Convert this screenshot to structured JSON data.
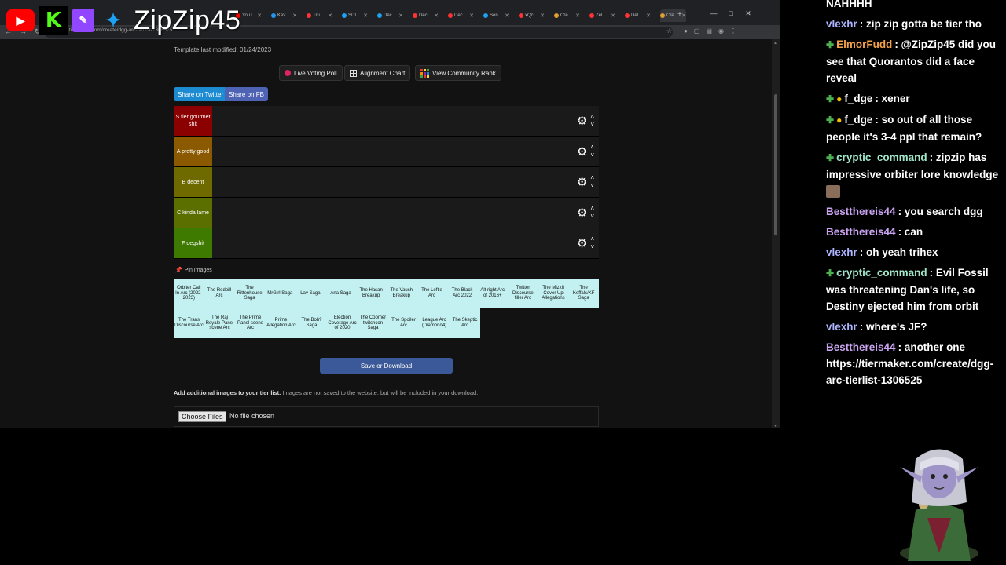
{
  "browser": {
    "tabs": [
      {
        "label": "YouT",
        "color": "#ff0000"
      },
      {
        "label": "Kev",
        "color": "#2196f3"
      },
      {
        "label": "Tru",
        "color": "#ff3333"
      },
      {
        "label": "SDI",
        "color": "#1da1f2"
      },
      {
        "label": "Dec",
        "color": "#1da1f2"
      },
      {
        "label": "Dec",
        "color": "#ff3333"
      },
      {
        "label": "Dec",
        "color": "#ff3333"
      },
      {
        "label": "Sen",
        "color": "#1da1f2"
      },
      {
        "label": "xQc",
        "color": "#ff3333"
      },
      {
        "label": "Cre",
        "color": "#e0a030"
      },
      {
        "label": "Zel",
        "color": "#ff3333"
      },
      {
        "label": "Del",
        "color": "#ff3333"
      },
      {
        "label": "Cre",
        "color": "#e0a030"
      }
    ],
    "url": "tiermaker.com/create/dgg-arc-tierlist-1306525"
  },
  "page": {
    "template_modified": "Template last modified: 01/24/2023",
    "buttons": {
      "live_poll": "Live Voting Poll",
      "alignment": "Alignment Chart",
      "community_rank": "View Community Rank",
      "share_twitter": "Share on Twitter",
      "share_fb": "Share on FB"
    },
    "tiers": [
      {
        "label": "S tier gourmet shit",
        "color": "#8b0000"
      },
      {
        "label": "A pretty good",
        "color": "#8b5a00"
      },
      {
        "label": "B decent",
        "color": "#6e6a00"
      },
      {
        "label": "C kinda lame",
        "color": "#5b6e00"
      },
      {
        "label": "F degshit",
        "color": "#3f7a00"
      }
    ],
    "pin_images": "Pin Images",
    "pool_rows": [
      [
        "Orbiter Call In Arc (2022-2023)",
        "The Redpill Arc",
        "The Rittenhouse Saga",
        "MrGirl Saga",
        "Lav Saga",
        "Ana Saga",
        "The Hasan Breakup",
        "The Vaush Breakup",
        "The Leftie Arc",
        "The Black Arc 2022",
        "Alt right Arc of 2016+",
        "Twitter Discourse filler Arc",
        "The Mizkif Cover Up Allegations",
        "The Keffals/KF Saga"
      ],
      [
        "The Trans Discourse Arc",
        "The Raj Royale Panel scene Arc",
        "The Prime Panel scene Arc",
        "Prime Allegation Arc",
        "The Bob? Saga",
        "Election Coverage Arc of 2020",
        "The Coomer twitchcon Saga",
        "The Spoiler Arc",
        "League Arc (Diamond4)",
        "The Skeptic Arc"
      ]
    ],
    "save_label": "Save or Download",
    "add_info_bold": "Add additional images to your tier list.",
    "add_info_rest": " Images are not saved to the website, but will be included in your download.",
    "choose_files": "Choose Files",
    "no_file": "No file chosen"
  },
  "overlay": {
    "handle": "ZipZip45"
  },
  "chat": [
    {
      "badges": [],
      "user": "",
      "color": "#ffffff",
      "text": "NAHHHH"
    },
    {
      "badges": [],
      "user": "vlexhr",
      "color": "#aeb4ff",
      "text": ": zip zip gotta be tier tho"
    },
    {
      "badges": [
        "g"
      ],
      "user": "ElmorFudd",
      "color": "#f4a24a",
      "text": ": @ZipZip45 did you see that Quorantos did a face reveal"
    },
    {
      "badges": [
        "g",
        "o"
      ],
      "user": "f_dge",
      "color": "#ffffff",
      "text": ": xener"
    },
    {
      "badges": [
        "g",
        "o"
      ],
      "user": "f_dge",
      "color": "#ffffff",
      "text": ": so out of all those people it's 3-4 ppl that remain?"
    },
    {
      "badges": [
        "g"
      ],
      "user": "cryptic_command",
      "color": "#9fe6c9",
      "text": ": zipzip has impressive orbiter lore knowledge",
      "emote": true
    },
    {
      "badges": [],
      "user": "Bestthereis44",
      "color": "#c9a3f0",
      "text": ": you search dgg"
    },
    {
      "badges": [],
      "user": "Bestthereis44",
      "color": "#c9a3f0",
      "text": ": can"
    },
    {
      "badges": [],
      "user": "vlexhr",
      "color": "#aeb4ff",
      "text": ": oh yeah trihex"
    },
    {
      "badges": [
        "g"
      ],
      "user": "cryptic_command",
      "color": "#9fe6c9",
      "text": ": Evil Fossil was threatening Dan's life, so Destiny ejected him from orbit"
    },
    {
      "badges": [],
      "user": "vlexhr",
      "color": "#aeb4ff",
      "text": ": where's JF?"
    },
    {
      "badges": [],
      "user": "Bestthereis44",
      "color": "#c9a3f0",
      "text": ": another one https://tiermaker.com/create/dgg-arc-tierlist-1306525"
    }
  ]
}
